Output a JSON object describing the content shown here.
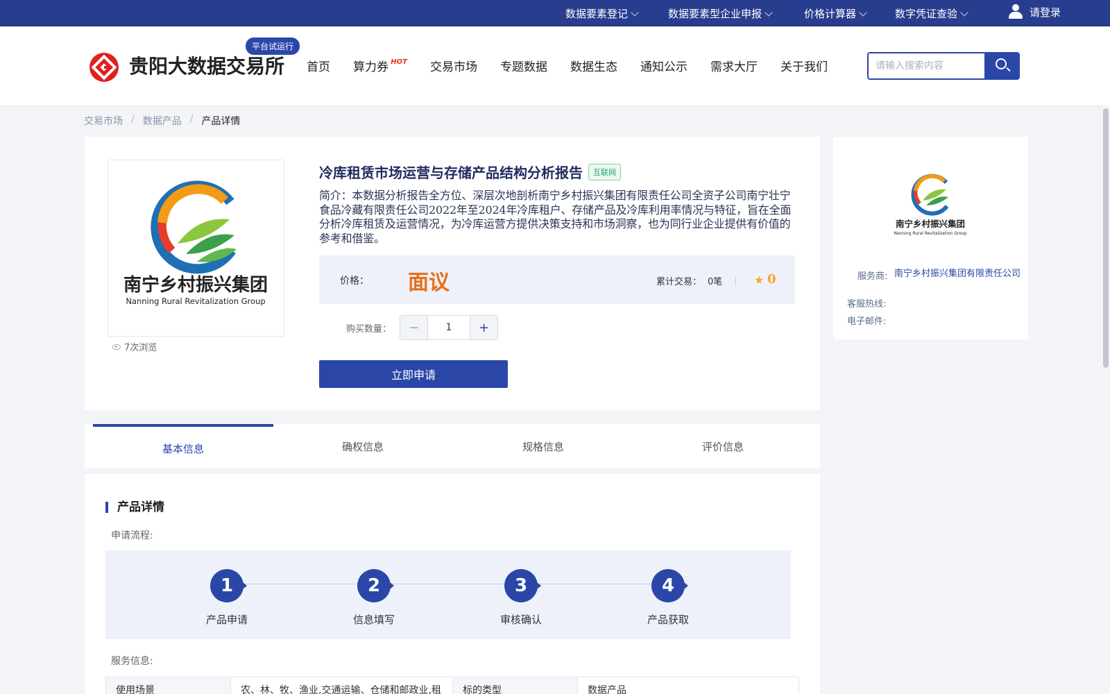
{
  "topbar": {
    "items": [
      {
        "label": "数据要素登记"
      },
      {
        "label": "数据要素型企业申报"
      },
      {
        "label": "价格计算器"
      },
      {
        "label": "数字凭证查验"
      }
    ],
    "login_label": "请登录"
  },
  "header": {
    "brand_name": "贵阳大数据交易所",
    "beta_badge": "平台试运行",
    "nav": [
      {
        "label": "首页"
      },
      {
        "label": "算力券",
        "tag": "HOT"
      },
      {
        "label": "交易市场"
      },
      {
        "label": "专题数据"
      },
      {
        "label": "数据生态"
      },
      {
        "label": "通知公示"
      },
      {
        "label": "需求大厅"
      },
      {
        "label": "关于我们"
      }
    ],
    "search_placeholder": "请输入搜索内容"
  },
  "breadcrumb": [
    "交易市场",
    "数据产品",
    "产品详情"
  ],
  "product": {
    "image_caption_cn": "南宁乡村振兴集团",
    "image_caption_en": "Nanning Rural Revitalization Group",
    "views": "7次浏览",
    "title": "冷库租赁市场运营与存储产品结构分析报告",
    "tag": "互联网",
    "description": "简介：本数据分析报告全方位、深层次地剖析南宁乡村振兴集团有限责任公司全资子公司南宁壮宁食品冷藏有限责任公司2022年至2024年冷库租户、存储产品及冷库利用率情况与特征，旨在全面分析冷库租赁及运营情况，为冷库运营方提供决策支持和市场洞察，也为同行业企业提供有价值的参考和借鉴。",
    "price_label": "价格：",
    "price_value": "面议",
    "trade_label": "累计交易：",
    "trade_value": "0笔",
    "rating": "0",
    "qty_label": "购买数量：",
    "qty_value": "1",
    "apply_label": "立即申请"
  },
  "provider": {
    "logo_caption_cn": "南宁乡村振兴集团",
    "logo_caption_en": "Nanning Rural Revitalization Group",
    "service_label": "服务商:",
    "service_value": "南宁乡村振兴集团有限责任公司",
    "hotline_label": "客服热线:",
    "email_label": "电子邮件:"
  },
  "tabs": [
    "基本信息",
    "确权信息",
    "规格信息",
    "评价信息"
  ],
  "detail": {
    "section_title": "产品详情",
    "flow_label": "申请流程:",
    "steps": [
      {
        "num": "1",
        "label": "产品申请"
      },
      {
        "num": "2",
        "label": "信息填写"
      },
      {
        "num": "3",
        "label": "审核确认"
      },
      {
        "num": "4",
        "label": "产品获取"
      }
    ],
    "service_label": "服务信息:",
    "table_row": [
      "使用场景",
      "农、林、牧、渔业,交通运输、仓储和邮政业,租",
      "标的类型",
      "数据产品"
    ]
  },
  "colors": {
    "primary": "#2a47a8",
    "topbar": "#283d8e",
    "price": "#e8701a",
    "rating": "#f5a623"
  }
}
